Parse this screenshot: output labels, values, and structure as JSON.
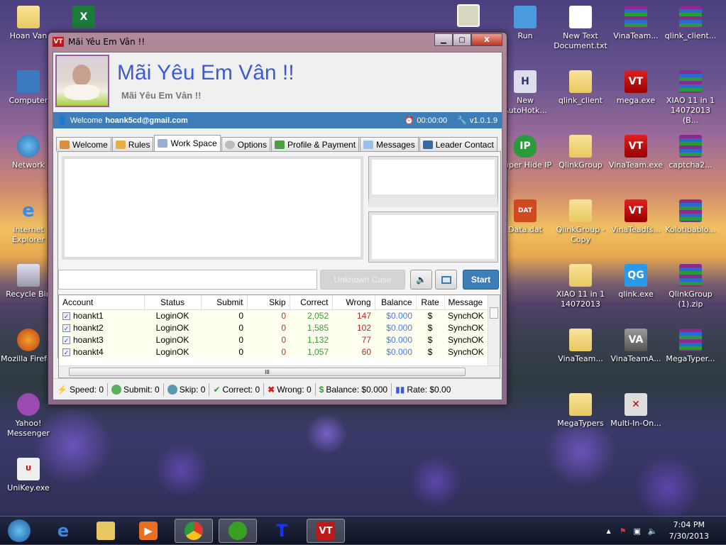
{
  "desktop": {
    "icons": [
      {
        "label": "Hoan Van",
        "icon": "folder-user-icon"
      },
      {
        "label": "",
        "icon": "excel-icon"
      },
      {
        "label": "Computer",
        "icon": "computer-icon"
      },
      {
        "label": "Network",
        "icon": "network-icon"
      },
      {
        "label": "Internet Explorer",
        "icon": "ie-icon"
      },
      {
        "label": "Recycle Bin",
        "icon": "recycle-bin-icon"
      },
      {
        "label": "Mozilla Firefox",
        "icon": "firefox-icon"
      },
      {
        "label": "Yahoo! Messenger",
        "icon": "yahoo-icon"
      },
      {
        "label": "UniKey.exe",
        "icon": "unikey-icon"
      },
      {
        "label": "",
        "icon": "photo-icon"
      },
      {
        "label": "Run",
        "icon": "run-icon"
      },
      {
        "label": "New Text Document.txt",
        "icon": "text-file-icon"
      },
      {
        "label": "VinaTeam...",
        "icon": "rar-icon"
      },
      {
        "label": "qlink_client...",
        "icon": "rar-icon"
      },
      {
        "label": "New AutoHotk...",
        "icon": "ahk-icon"
      },
      {
        "label": "qlink_client",
        "icon": "folder-icon"
      },
      {
        "label": "mega.exe",
        "icon": "vt-icon"
      },
      {
        "label": "XIAO 11 in 1 14072013 (B...",
        "icon": "rar-icon"
      },
      {
        "label": "Super Hide IP",
        "icon": "hide-ip-icon"
      },
      {
        "label": "QlinkGroup",
        "icon": "folder-icon"
      },
      {
        "label": "VinaTeam.exe",
        "icon": "vt-icon"
      },
      {
        "label": "captcha2...",
        "icon": "rar-icon"
      },
      {
        "label": "Data.dat",
        "icon": "dat-icon"
      },
      {
        "label": "QlinkGroup - Copy",
        "icon": "folder-icon"
      },
      {
        "label": "VinaTeadfs...",
        "icon": "vt-icon"
      },
      {
        "label": "Kolotibablo...",
        "icon": "rar-icon"
      },
      {
        "label": "XIAO 11 in 1 14072013",
        "icon": "folder-icon"
      },
      {
        "label": "qlink.exe",
        "icon": "qg-icon"
      },
      {
        "label": "QlinkGroup (1).zip",
        "icon": "rar-icon"
      },
      {
        "label": "VinaTeam...",
        "icon": "folder-icon"
      },
      {
        "label": "VinaTeamA...",
        "icon": "va-icon"
      },
      {
        "label": "MegaTyper...",
        "icon": "rar-icon"
      },
      {
        "label": "MegaTypers",
        "icon": "folder-icon"
      },
      {
        "label": "Multi-In-On...",
        "icon": "tools-icon"
      }
    ]
  },
  "window": {
    "title": "Mãi Yêu Em Vân !!",
    "logo": "VT",
    "close": "X",
    "header": {
      "title": "Mãi Yêu Em Vân !!",
      "subtitle": "Mãi Yêu Em Vân !!"
    },
    "bar": {
      "welcome": "Welcome",
      "user": "hoank5cd@gmail.com",
      "timer": "00:00:00",
      "version": "v1.0.1.9"
    },
    "tabs": [
      "Welcome",
      "Rules",
      "Work Space",
      "Options",
      "Profile & Payment",
      "Messages",
      "Leader Contact"
    ],
    "active_tab": "Work Space",
    "workspace": {
      "input_value": "",
      "unknown_case": "Unknown Case",
      "start": "Start"
    },
    "grid": {
      "columns": [
        "Account",
        "Status",
        "Submit",
        "Skip",
        "Correct",
        "Wrong",
        "Balance",
        "Rate",
        "Message"
      ],
      "rows": [
        [
          "hoankt1",
          "LoginOK",
          "0",
          "0",
          "2,052",
          "147",
          "$0.000",
          "$",
          "SynchOK"
        ],
        [
          "hoankt2",
          "LoginOK",
          "0",
          "0",
          "1,585",
          "102",
          "$0.000",
          "$",
          "SynchOK"
        ],
        [
          "hoankt3",
          "LoginOK",
          "0",
          "0",
          "1,132",
          "77",
          "$0.000",
          "$",
          "SynchOK"
        ],
        [
          "hoankt4",
          "LoginOK",
          "0",
          "0",
          "1,057",
          "60",
          "$0.000",
          "$",
          "SynchOK"
        ]
      ],
      "scroll_grip": "III"
    },
    "status": {
      "speed": "Speed: 0",
      "submit": "Submit: 0",
      "skip": "Skip: 0",
      "correct": "Correct: 0",
      "wrong": "Wrong: 0",
      "balance": "Balance: $0.000",
      "rate": "Rate: $0.00"
    }
  },
  "taskbar": {
    "time": "7:04 PM",
    "date": "7/30/2013",
    "apps": [
      "start",
      "internet-explorer",
      "windows-explorer",
      "media-player",
      "chrome",
      "green-browser",
      "t-app",
      "vt-app"
    ]
  },
  "colors": {
    "accent_blue": "#3d7db8",
    "correct": "#3a9a3a",
    "wrong": "#b02a2a",
    "balance": "#4a7ae0",
    "skip": "#c03030"
  }
}
